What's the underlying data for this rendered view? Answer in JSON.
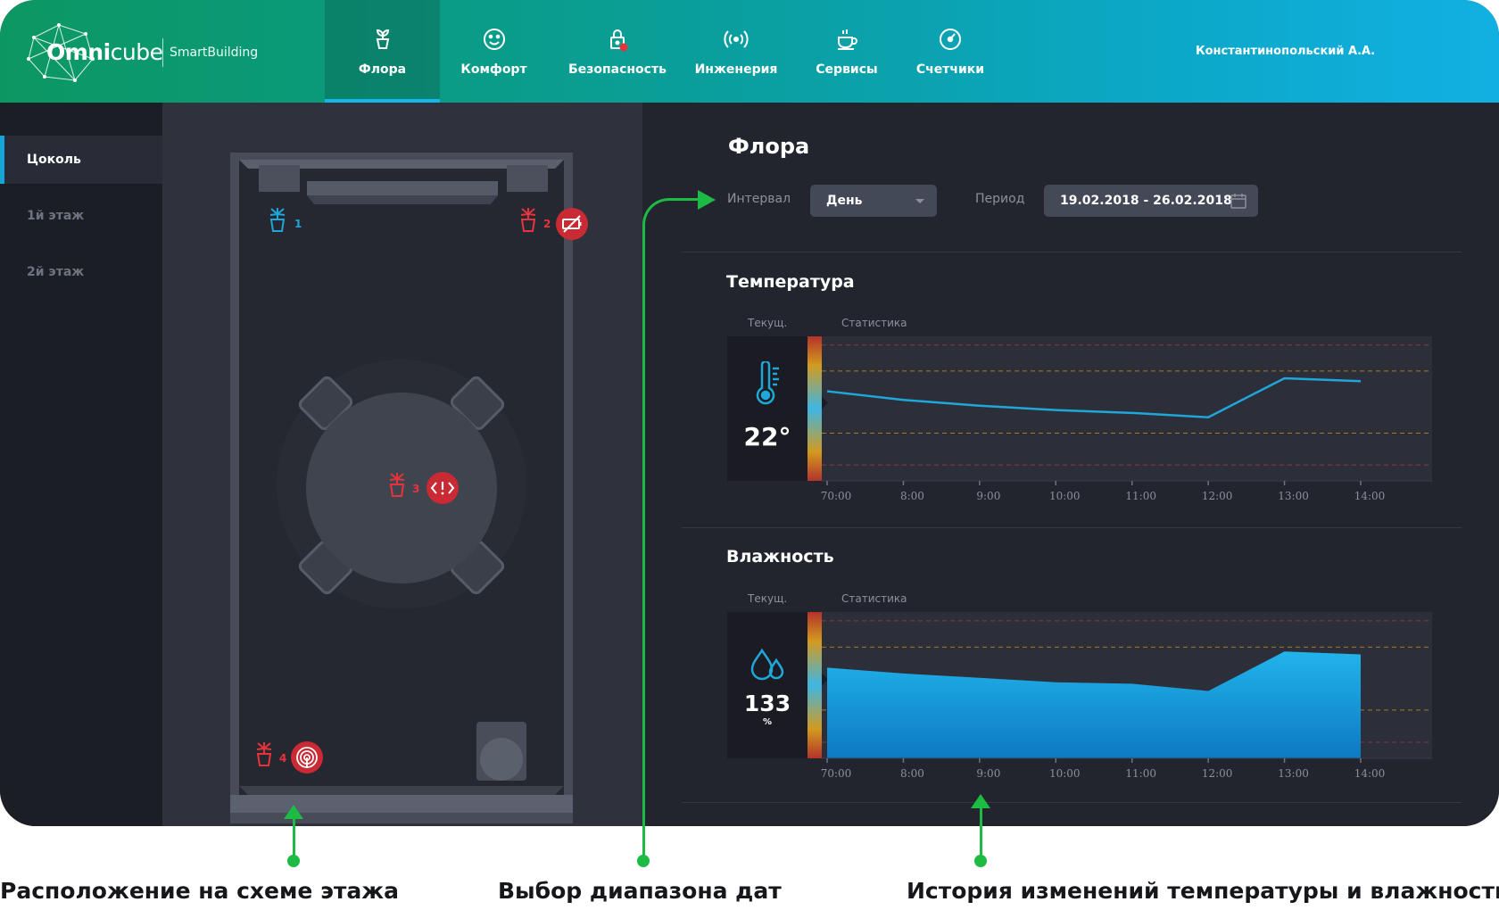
{
  "brand": {
    "name_bold": "Omni",
    "name_rest": "cube",
    "sub": "SmartBuilding"
  },
  "nav": [
    {
      "label": "Флора",
      "icon": "plant-icon",
      "active": true
    },
    {
      "label": "Комфорт",
      "icon": "smiley-icon"
    },
    {
      "label": "Безопасность",
      "icon": "lock-icon",
      "alert_color": "#e8333d"
    },
    {
      "label": "Инженерия",
      "icon": "signal-icon"
    },
    {
      "label": "Сервисы",
      "icon": "coffee-cup-icon"
    },
    {
      "label": "Счетчики",
      "icon": "gauge-icon"
    }
  ],
  "user": {
    "name": "Константинопольский А.А."
  },
  "floors": [
    {
      "label": "Цоколь",
      "active": true
    },
    {
      "label": "1й этаж"
    },
    {
      "label": "2й этаж"
    }
  ],
  "plan": {
    "plants": [
      {
        "number": "1",
        "status": "ok",
        "color": "#1fa7d9"
      },
      {
        "number": "2",
        "status": "battery-empty",
        "color": "#e8333d",
        "badge_icon": "no-battery-icon"
      },
      {
        "number": "3",
        "status": "error",
        "color": "#e8333d",
        "badge_icon": "code-alert-icon"
      },
      {
        "number": "4",
        "status": "signal",
        "color": "#e8333d",
        "badge_icon": "wireless-signal-icon"
      }
    ]
  },
  "main": {
    "title": "Флора",
    "interval_label": "Интервал",
    "interval_value": "День",
    "period_label": "Период",
    "period_value": "19.02.2018 - 26.02.2018"
  },
  "temperature": {
    "title": "Температура",
    "current_label": "Текущ.",
    "stats_label": "Статистика",
    "current_value": "22°",
    "icon": "thermometer-icon"
  },
  "humidity": {
    "title": "Влажность",
    "current_label": "Текущ.",
    "stats_label": "Статистика",
    "current_value": "133",
    "unit": "%",
    "icon": "water-drops-icon"
  },
  "chart_data": [
    {
      "type": "line",
      "title": "Температура",
      "x": [
        "70:00",
        "8:00",
        "9:00",
        "10:00",
        "11:00",
        "12:00",
        "13:00",
        "14:00"
      ],
      "series": [
        {
          "values": [
            0.62,
            0.56,
            0.52,
            0.49,
            0.47,
            0.44,
            0.71,
            0.69
          ]
        }
      ],
      "line_color": "#1fa7d9",
      "grid": "dashed thresholds"
    },
    {
      "type": "area",
      "title": "Влажность",
      "x": [
        "70:00",
        "8:00",
        "9:00",
        "10:00",
        "11:00",
        "12:00",
        "13:00",
        "14:00"
      ],
      "series": [
        {
          "values": [
            0.62,
            0.58,
            0.55,
            0.52,
            0.51,
            0.46,
            0.73,
            0.71
          ]
        }
      ],
      "fill_color": "#1aa3dc",
      "grid": "dashed thresholds"
    }
  ],
  "annotations": {
    "plan": "Расположение на схеме этажа",
    "dates": "Выбор диапазона дат",
    "history": "История изменений температуры и влажности"
  }
}
